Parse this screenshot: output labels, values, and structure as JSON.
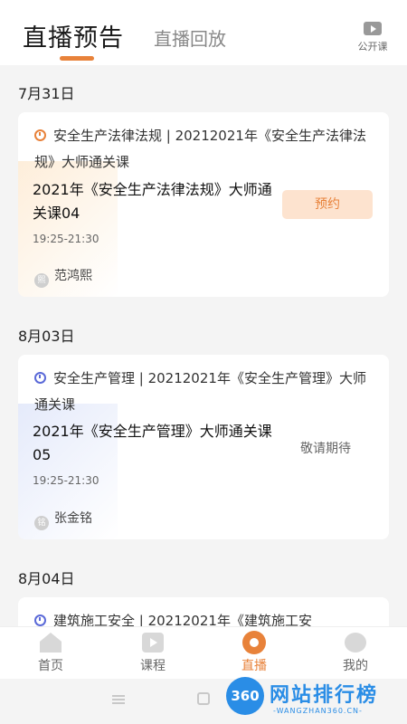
{
  "header": {
    "active_tab": "直播预告",
    "inactive_tab": "直播回放",
    "open_class_label": "公开课",
    "accent": "#e8823a"
  },
  "sections": [
    {
      "date": "7月31日",
      "course": "安全生产法律法规 | 20212021年《安全生产法律法规》大师通关课",
      "lesson": "2021年《安全生产法律法规》大师通关课04",
      "time": "19:25-21:30",
      "teacher": "范鸿熙",
      "action": "预约"
    },
    {
      "date": "8月03日",
      "course": "安全生产管理 | 20212021年《安全生产管理》大师通关课",
      "lesson": "2021年《安全生产管理》大师通关课05",
      "time": "19:25-21:30",
      "teacher": "张金铭",
      "action": "敬请期待"
    },
    {
      "date": "8月04日",
      "course": "建筑施工安全 | 20212021年《建筑施工安"
    }
  ],
  "tabbar": [
    {
      "label": "首页",
      "icon": "home-icon"
    },
    {
      "label": "课程",
      "icon": "play-icon"
    },
    {
      "label": "直播",
      "icon": "live-icon",
      "active": true
    },
    {
      "label": "我的",
      "icon": "user-icon"
    }
  ],
  "brand": {
    "badge": "360",
    "name": "网站排行榜",
    "url": "-WANGZHAN360.CN-"
  }
}
